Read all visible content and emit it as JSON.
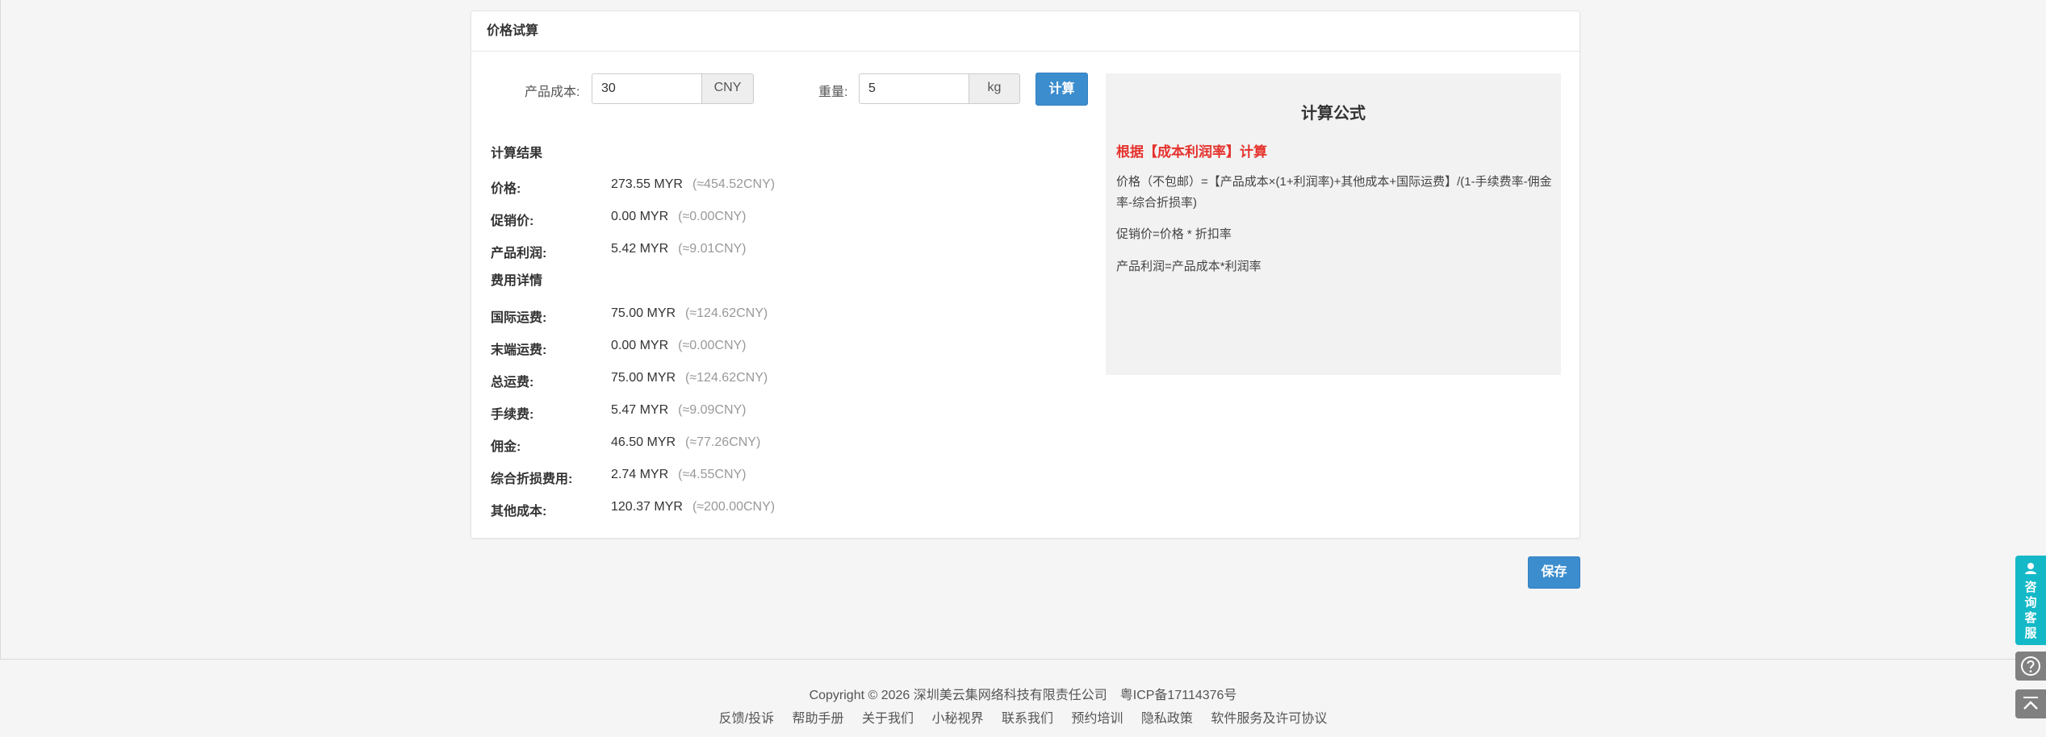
{
  "panel": {
    "title": "价格试算"
  },
  "form": {
    "cost_label": "产品成本:",
    "cost_value": "30",
    "cost_unit": "CNY",
    "weight_label": "重量:",
    "weight_value": "5",
    "weight_unit": "kg",
    "calc_button": "计算"
  },
  "results": {
    "title": "计算结果",
    "rows": [
      {
        "label": "价格:",
        "value": "273.55 MYR",
        "cny": "(≈454.52CNY)"
      },
      {
        "label": "促销价:",
        "value": "0.00 MYR",
        "cny": "(≈0.00CNY)"
      },
      {
        "label": "产品利润:",
        "value": "5.42 MYR",
        "cny": "(≈9.01CNY)"
      }
    ]
  },
  "fees": {
    "title": "费用详情",
    "rows": [
      {
        "label": "国际运费:",
        "value": "75.00 MYR",
        "cny": "(≈124.62CNY)"
      },
      {
        "label": "末端运费:",
        "value": "0.00 MYR",
        "cny": "(≈0.00CNY)"
      },
      {
        "label": "总运费:",
        "value": "75.00 MYR",
        "cny": "(≈124.62CNY)"
      },
      {
        "label": "手续费:",
        "value": "5.47 MYR",
        "cny": "(≈9.09CNY)"
      },
      {
        "label": "佣金:",
        "value": "46.50 MYR",
        "cny": "(≈77.26CNY)"
      },
      {
        "label": "综合折损费用:",
        "value": "2.74 MYR",
        "cny": "(≈4.55CNY)"
      },
      {
        "label": "其他成本:",
        "value": "120.37 MYR",
        "cny": "(≈200.00CNY)"
      }
    ]
  },
  "formula": {
    "title": "计算公式",
    "subtitle": "根据【成本利润率】计算",
    "line1": "价格（不包邮）=【产品成本×(1+利润率)+其他成本+国际运费】/(1-手续费率-佣金率-综合折损率)",
    "line2": "促销价=价格 * 折扣率",
    "line3": "产品利润=产品成本*利润率"
  },
  "save_button": "保存",
  "footer": {
    "copyright": "Copyright © 2026 深圳美云集网络科技有限责任公司　粤ICP备17114376号",
    "links": [
      "反馈/投诉",
      "帮助手册",
      "关于我们",
      "小秘视界",
      "联系我们",
      "预约培训",
      "隐私政策",
      "软件服务及许可协议"
    ]
  },
  "sidebar": {
    "kefu_label": "咨询客服",
    "help_icon": "question-circle-icon",
    "top_icon": "chevron-up-icon"
  },
  "colors": {
    "primary": "#3c8dce",
    "danger": "#e5322d",
    "kefu": "#14b9c8"
  }
}
